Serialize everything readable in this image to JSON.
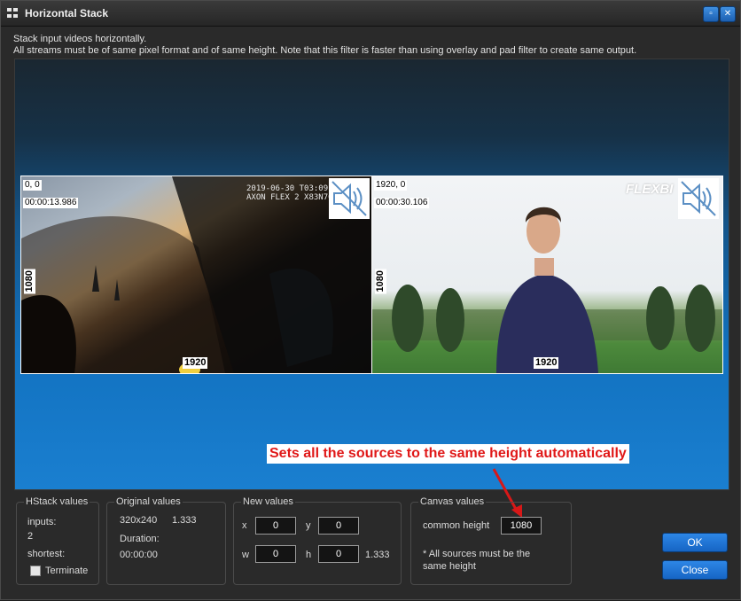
{
  "window": {
    "title": "Horizontal Stack",
    "restore_glyph": "▫",
    "close_glyph": "✕"
  },
  "description": {
    "line1": "Stack input videos horizontally.",
    "line2": "All streams must be of same pixel format and of same height.  Note that this filter is faster than using overlay and pad filter to create same output."
  },
  "preview": {
    "left": {
      "coords": "0, 0",
      "time": "00:00:13.986",
      "width_label": "1920",
      "height_label": "1080",
      "stamp_line1": "2019-06-30 T03:09:19",
      "stamp_line2": "AXON FLEX 2 X83N7037"
    },
    "right": {
      "coords": "1920, 0",
      "time": "00:00:30.106",
      "width_label": "1920",
      "height_label": "1080",
      "logo": "FLEXBI"
    }
  },
  "annotation": {
    "text": "Sets all the sources to the same height automatically",
    "color": "#e01818"
  },
  "hstack": {
    "legend": "HStack values",
    "inputs_label": "inputs:",
    "inputs_value": "2",
    "shortest_label": "shortest:",
    "terminate_label": "Terminate"
  },
  "original": {
    "legend": "Original values",
    "size": "320x240",
    "ratio": "1.333",
    "duration_label": "Duration:",
    "duration": "00:00:00"
  },
  "new_values": {
    "legend": "New values",
    "x_label": "x",
    "x_value": "0",
    "y_label": "y",
    "y_value": "0",
    "w_label": "w",
    "w_value": "0",
    "h_label": "h",
    "h_value": "0",
    "ratio": "1.333"
  },
  "canvas_values": {
    "legend": "Canvas values",
    "common_height_label": "common height",
    "common_height_value": "1080",
    "note_line1": "* All sources must be the",
    "note_line2": "same height"
  },
  "buttons": {
    "ok": "OK",
    "close": "Close"
  },
  "colors": {
    "accent": "#1e74d6",
    "window_bg": "#2a2a2a"
  }
}
